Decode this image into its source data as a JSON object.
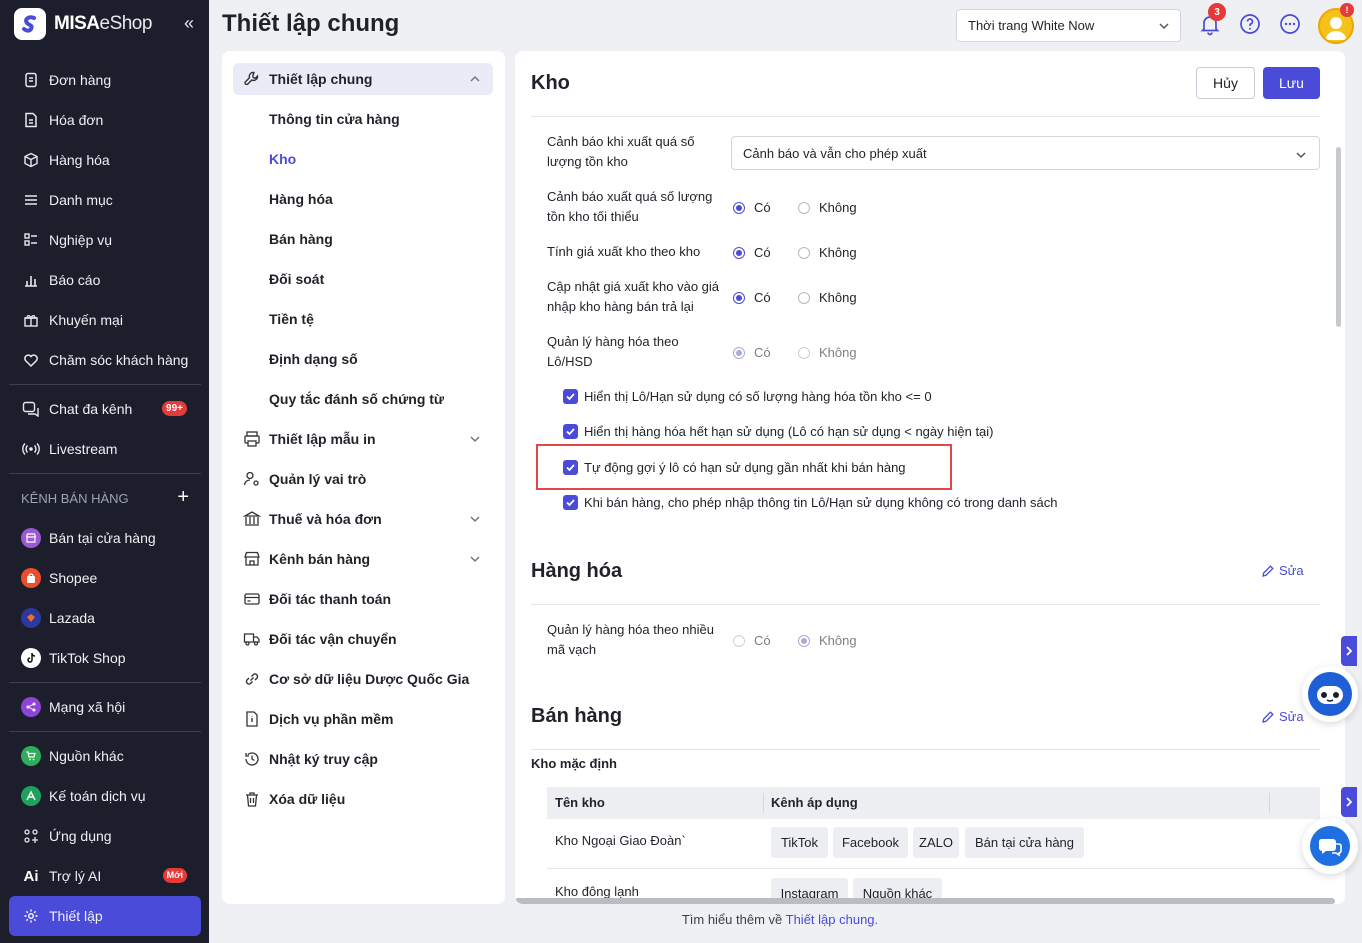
{
  "app": {
    "brand_bold": "MISA",
    "brand_thin": "eShop",
    "collapse_glyph": "«"
  },
  "sidebar": {
    "items": [
      {
        "label": "Đơn hàng",
        "icon": "order-icon"
      },
      {
        "label": "Hóa đơn",
        "icon": "invoice-icon"
      },
      {
        "label": "Hàng hóa",
        "icon": "box-icon"
      },
      {
        "label": "Danh mục",
        "icon": "list-icon"
      },
      {
        "label": "Nghiệp vụ",
        "icon": "tasks-icon"
      },
      {
        "label": "Báo cáo",
        "icon": "chart-icon"
      },
      {
        "label": "Khuyến mại",
        "icon": "gift-icon"
      },
      {
        "label": "Chăm sóc khách hàng",
        "icon": "heart-icon"
      }
    ],
    "chat_label": "Chat đa kênh",
    "chat_badge": "99+",
    "livestream_label": "Livestream",
    "channels_title": "KÊNH BÁN HÀNG",
    "add_glyph": "+",
    "channels": [
      {
        "label": "Bán tại cửa hàng",
        "color": "#9b59d6"
      },
      {
        "label": "Shopee",
        "color": "#ee4d2d"
      },
      {
        "label": "Lazada",
        "color": "#2a3a9e"
      },
      {
        "label": "TikTok Shop",
        "color": "#ffffff"
      }
    ],
    "social_label": "Mạng xã hội",
    "other_source_label": "Nguồn khác",
    "accounting_label": "Kế toán dịch vụ",
    "apps_label": "Ứng dụng",
    "ai_label": "Trợ lý AI",
    "ai_badge": "Mới",
    "settings_label": "Thiết lập"
  },
  "header": {
    "title": "Thiết lập chung",
    "store": "Thời trang White Now",
    "notification_count": "3",
    "avatar_badge": "!"
  },
  "settings_menu": {
    "general": "Thiết lập chung",
    "sub": [
      "Thông tin cửa hàng",
      "Kho",
      "Hàng hóa",
      "Bán hàng",
      "Đối soát",
      "Tiền tệ",
      "Định dạng số",
      "Quy tắc đánh số chứng từ"
    ],
    "current_index": 1,
    "items": [
      {
        "label": "Thiết lập mẫu in",
        "icon": "printer-icon",
        "expand": true
      },
      {
        "label": "Quản lý vai trò",
        "icon": "user-role-icon",
        "expand": false
      },
      {
        "label": "Thuế và hóa đơn",
        "icon": "bank-icon",
        "expand": true
      },
      {
        "label": "Kênh bán hàng",
        "icon": "store-icon",
        "expand": true
      },
      {
        "label": "Đối tác thanh toán",
        "icon": "card-icon",
        "expand": false
      },
      {
        "label": "Đối tác vận chuyển",
        "icon": "truck-icon",
        "expand": false
      },
      {
        "label": "Cơ sở dữ liệu Dược Quốc Gia",
        "icon": "link-icon",
        "expand": false
      },
      {
        "label": "Dịch vụ phần mềm",
        "icon": "file-icon",
        "expand": false
      },
      {
        "label": "Nhật ký truy cập",
        "icon": "history-icon",
        "expand": false
      },
      {
        "label": "Xóa dữ liệu",
        "icon": "trash-icon",
        "expand": false
      }
    ]
  },
  "kho": {
    "title": "Kho",
    "cancel": "Hủy",
    "save": "Lưu",
    "warn_export_label": "Cảnh báo khi xuất quá số lượng tồn kho",
    "warn_export_value": "Cảnh báo và vẫn cho phép xuất",
    "yes": "Có",
    "no": "Không",
    "rows": [
      {
        "label": "Cảnh báo xuất quá số lượng tồn kho tối thiểu",
        "value": "yes",
        "disabled": false
      },
      {
        "label": "Tính giá xuất kho theo kho",
        "value": "yes",
        "disabled": false
      },
      {
        "label": "Cập nhật giá xuất kho vào giá nhập kho hàng bán trả lại",
        "value": "yes",
        "disabled": false
      },
      {
        "label": "Quản lý hàng hóa theo Lô/HSD",
        "value": "yes",
        "disabled": true
      }
    ],
    "checks": [
      "Hiển thị Lô/Hạn sử dụng có số lượng hàng hóa tồn kho <= 0",
      "Hiển thị hàng hóa hết hạn sử dụng (Lô có hạn sử dụng < ngày hiện tại)",
      "Tự động gợi ý lô có hạn sử dụng gần nhất khi bán hàng",
      "Khi bán hàng, cho phép nhập thông tin Lô/Hạn sử dụng không có trong danh sách"
    ]
  },
  "hang_hoa": {
    "title": "Hàng hóa",
    "edit": "Sửa",
    "row_label": "Quản lý hàng hóa theo nhiều mã vạch",
    "value": "no"
  },
  "ban_hang": {
    "title": "Bán hàng",
    "edit": "Sửa",
    "default_warehouse": "Kho mặc định",
    "col_name": "Tên kho",
    "col_channels": "Kênh áp dụng",
    "rows": [
      {
        "name": "Kho Ngoại Giao Đoàn`",
        "tags": [
          "TikTok",
          "Facebook",
          "ZALO",
          "Bán tại cửa hàng"
        ]
      },
      {
        "name": "Kho đông lạnh",
        "tags": [
          "Instagram",
          "Nguồn khác"
        ]
      }
    ]
  },
  "footer": {
    "text": "Tìm hiểu thêm về ",
    "link": "Thiết lập chung."
  },
  "colors": {
    "accent": "#4a4cd9",
    "sidebar_bg": "#1c1f2b",
    "highlight": "#e04848"
  }
}
